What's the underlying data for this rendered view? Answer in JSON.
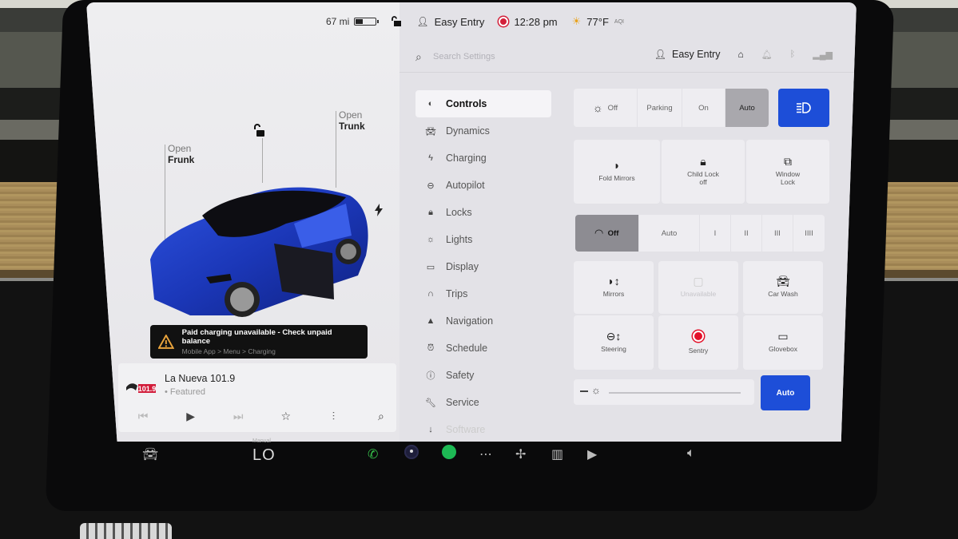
{
  "status_bar": {
    "range": "67 mi",
    "battery_level": 0.35,
    "lock_state": "unlocked",
    "profile": "Easy Entry",
    "recording": true,
    "time": "12:28 pm",
    "temperature": "77°F",
    "aqi_label": "AQI"
  },
  "car_panel": {
    "frunk": {
      "line1": "Open",
      "line2": "Frunk"
    },
    "trunk": {
      "line1": "Open",
      "line2": "Trunk"
    },
    "car_color": "#1f3fc0",
    "alert": {
      "title": "Paid charging unavailable - Check unpaid balance",
      "subtitle": "Mobile App > Menu > Charging"
    }
  },
  "media": {
    "station": "La Nueva 101.9",
    "source": "Featured",
    "logo_text": "101.9"
  },
  "settings": {
    "search_placeholder": "Search Settings",
    "profile": "Easy Entry",
    "nav": [
      {
        "label": "Controls",
        "icon": "toggle-icon",
        "active": true
      },
      {
        "label": "Dynamics",
        "icon": "car-icon"
      },
      {
        "label": "Charging",
        "icon": "bolt-icon"
      },
      {
        "label": "Autopilot",
        "icon": "steering-wheel-icon"
      },
      {
        "label": "Locks",
        "icon": "lock-icon"
      },
      {
        "label": "Lights",
        "icon": "light-icon"
      },
      {
        "label": "Display",
        "icon": "display-icon"
      },
      {
        "label": "Trips",
        "icon": "trips-icon"
      },
      {
        "label": "Navigation",
        "icon": "navigation-icon"
      },
      {
        "label": "Schedule",
        "icon": "alarm-icon"
      },
      {
        "label": "Safety",
        "icon": "safety-icon"
      },
      {
        "label": "Service",
        "icon": "wrench-icon"
      },
      {
        "label": "Software",
        "icon": "download-icon"
      }
    ],
    "headlights": {
      "options": [
        "Off",
        "Parking",
        "On",
        "Auto"
      ],
      "selected": "Auto"
    },
    "tiles_row1": [
      {
        "label": "Fold Mirrors",
        "sub": ""
      },
      {
        "label": "Child Lock",
        "sub": "off"
      },
      {
        "label": "Window",
        "sub": "Lock"
      }
    ],
    "wipers": {
      "options": [
        "Off",
        "Auto",
        "I",
        "II",
        "III",
        "IIII"
      ],
      "selected": "Off"
    },
    "tiles_row2": [
      {
        "label": "Mirrors"
      },
      {
        "label": "Unavailable"
      },
      {
        "label": "Car Wash"
      }
    ],
    "tiles_row3": [
      {
        "label": "Steering"
      },
      {
        "label": "Sentry"
      },
      {
        "label": "Glovebox"
      }
    ],
    "brightness": {
      "auto_label": "Auto",
      "level": 0.0
    }
  },
  "dock": {
    "climate_mode": "Manual",
    "climate_temp": "LO"
  },
  "colors": {
    "accent_blue": "#1d4ed8",
    "record_red": "#d3203a",
    "phone_green": "#36c04a",
    "spotify_green": "#1db954"
  }
}
